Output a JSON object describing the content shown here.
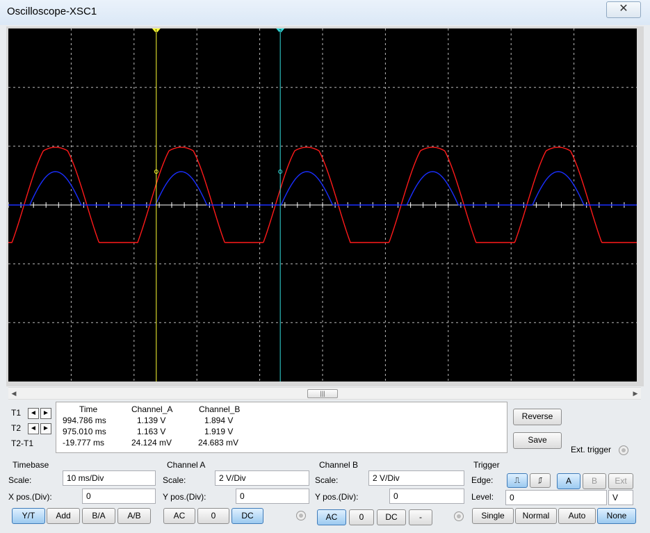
{
  "window": {
    "title": "Oscilloscope-XSC1",
    "close_glyph": "✕"
  },
  "cursors": {
    "t1_marker": "T1 cursor (yellow)",
    "t2_marker": "T2 cursor (cyan)",
    "t1_position": 0.2354,
    "t2_position": 0.4327
  },
  "readout": {
    "row_labels": [
      "T1",
      "T2",
      "T2-T1"
    ],
    "headers": [
      "Time",
      "Channel_A",
      "Channel_B"
    ],
    "rows": [
      [
        "994.786 ms",
        "1.139 V",
        "1.894 V"
      ],
      [
        "975.010 ms",
        "1.163 V",
        "1.919 V"
      ],
      [
        "-19.777 ms",
        "24.124 mV",
        "24.683 mV"
      ]
    ]
  },
  "side_buttons": {
    "reverse": "Reverse",
    "save": "Save",
    "ext_trigger": "Ext. trigger"
  },
  "timebase": {
    "title": "Timebase",
    "scale_label": "Scale:",
    "scale_value": "10 ms/Div",
    "xpos_label": "X pos.(Div):",
    "xpos_value": "0",
    "modes": [
      "Y/T",
      "Add",
      "B/A",
      "A/B"
    ],
    "active_mode": "Y/T"
  },
  "channel_a": {
    "title": "Channel A",
    "scale_label": "Scale:",
    "scale_value": "2  V/Div",
    "ypos_label": "Y pos.(Div):",
    "ypos_value": "0",
    "coupling": [
      "AC",
      "0",
      "DC"
    ],
    "active_coupling": "DC"
  },
  "channel_b": {
    "title": "Channel B",
    "scale_label": "Scale:",
    "scale_value": "2  V/Div",
    "ypos_label": "Y pos.(Div):",
    "ypos_value": "0",
    "coupling": [
      "AC",
      "0",
      "DC",
      "-"
    ],
    "active_coupling": "AC"
  },
  "trigger": {
    "title": "Trigger",
    "edge_label": "Edge:",
    "level_label": "Level:",
    "level_value": "0",
    "level_unit": "V",
    "sources": [
      "A",
      "B",
      "Ext"
    ],
    "active_source": "A",
    "modes": [
      "Single",
      "Normal",
      "Auto",
      "None"
    ],
    "active_mode": "None"
  },
  "colors": {
    "channel_a": "#ff1a1a",
    "channel_b": "#1a2fff",
    "cursor_t1": "#ffff33",
    "cursor_t2": "#33dddd",
    "screen": "#000000"
  }
}
